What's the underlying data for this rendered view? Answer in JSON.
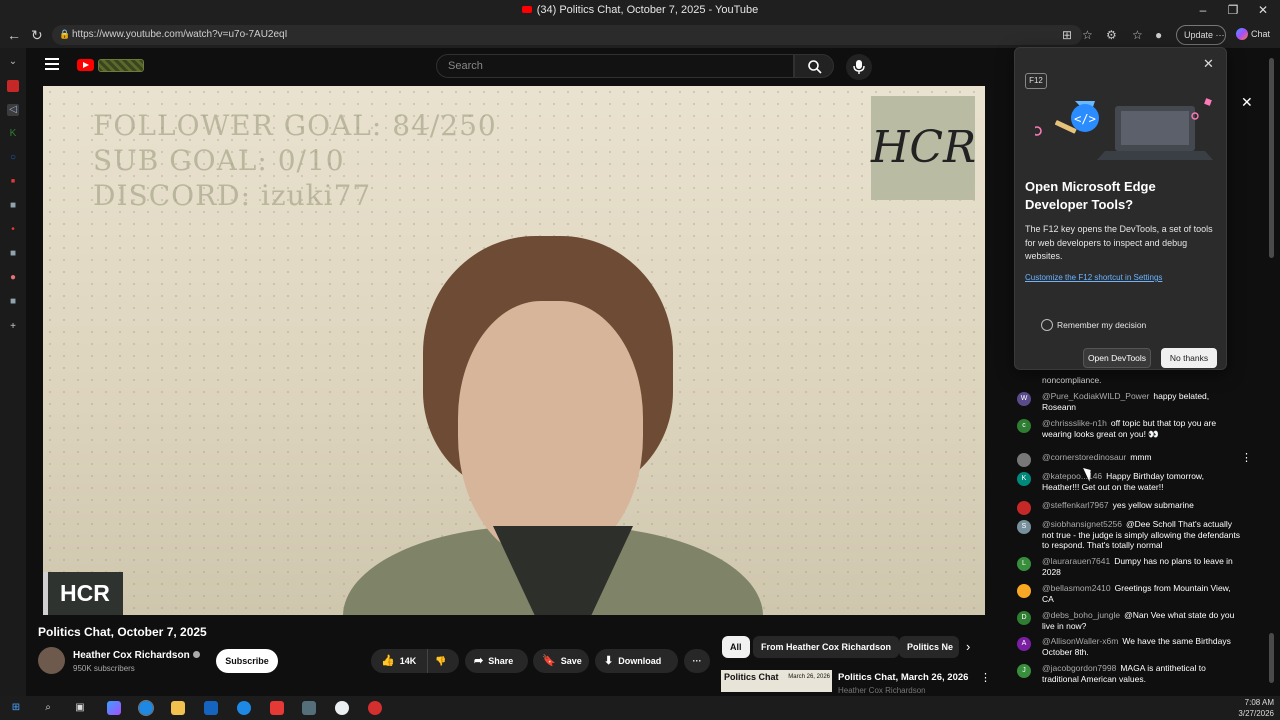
{
  "window": {
    "title": "(34) Politics Chat, October 7, 2025 - YouTube"
  },
  "browser": {
    "url": "https://www.youtube.com/watch?v=u7o-7AU2eqI",
    "update_label": "Update",
    "chat_label": "Chat"
  },
  "youtube": {
    "search_placeholder": "Search"
  },
  "video": {
    "overlay_lines": [
      "FOLLOWER GOAL: 84/250",
      "SUB GOAL: 0/10",
      "DISCORD: izuki77"
    ],
    "overlay_text": "FOLLOWER GOAL: 84/250\nSUB GOAL: 0/10\nDISCORD: izuki77",
    "sign_text": "HCR",
    "badge_text": "HCR",
    "title": "Politics Chat, October 7, 2025"
  },
  "channel": {
    "name": "Heather Cox Richardson",
    "subscribers": "950K subscribers",
    "subscribe_label": "Subscribe"
  },
  "actions": {
    "likes": "14K",
    "share": "Share",
    "save": "Save",
    "download": "Download",
    "more": "···"
  },
  "recommendations": {
    "chips": [
      "All",
      "From Heather Cox Richardson",
      "Politics Ne"
    ],
    "item": {
      "thumb_title": "Politics Chat",
      "thumb_date": "March 26, 2026",
      "title": "Politics Chat, March 26, 2026",
      "channel": "Heather Cox Richardson"
    }
  },
  "chat": {
    "partial_top": "noncompliance.",
    "messages": [
      {
        "author": "@Pure_KodiakWILD_Power",
        "text": "happy belated, Roseann",
        "initial": "W",
        "color": "#5a4a8a"
      },
      {
        "author": "@chrissslike-n1h",
        "text": "off topic but that top you are wearing looks great on you! 👀",
        "initial": "c",
        "color": "#2e7d32"
      },
      {
        "author": "@cornerstoredinosaur",
        "text": "mmm",
        "initial": "",
        "color": "#777777"
      },
      {
        "author": "@katepoo...146",
        "text": "Happy Birthday tomorrow, Heather!!! Get out on the water!!",
        "initial": "K",
        "color": "#00897b"
      },
      {
        "author": "@steffenkarl7967",
        "text": "yes yellow submarine",
        "initial": "",
        "color": "#c62828"
      },
      {
        "author": "@siobhansignet5256",
        "text": "@Dee Scholl That's actually not true - the judge is simply allowing the defendants to respond. That's totally normal",
        "initial": "S",
        "color": "#78909c"
      },
      {
        "author": "@laurarauen7641",
        "text": "Dumpy has no plans to leave in 2028",
        "initial": "L",
        "color": "#388e3c"
      },
      {
        "author": "@bellasmom2410",
        "text": "Greetings from Mountain View, CA",
        "initial": "",
        "color": "#f9a825"
      },
      {
        "author": "@debs_boho_jungle",
        "text": "@Nan Vee what state do you live in now?",
        "initial": "D",
        "color": "#2e7d32"
      },
      {
        "author": "@AllisonWaller-x6m",
        "text": "We have the same Birthdays October 8th.",
        "initial": "A",
        "color": "#7b1fa2"
      },
      {
        "author": "@jacobgordon7998",
        "text": "MAGA is antithetical to traditional American values.",
        "initial": "J",
        "color": "#388e3c"
      }
    ]
  },
  "devtools_popup": {
    "key": "F12",
    "title": "Open Microsoft Edge Developer Tools?",
    "body": "The F12 key opens the DevTools, a set of tools for web developers to inspect and debug websites.",
    "link": "Customize the F12 shortcut in Settings",
    "remember": "Remember my decision",
    "open_button": "Open DevTools",
    "no_button": "No thanks"
  },
  "taskbar": {
    "time": "7:08 AM",
    "date": "3/27/2026"
  },
  "colors": {
    "accent_red": "#ff0000",
    "link_blue": "#6cb4ff",
    "bg": "#0f0f0f"
  }
}
